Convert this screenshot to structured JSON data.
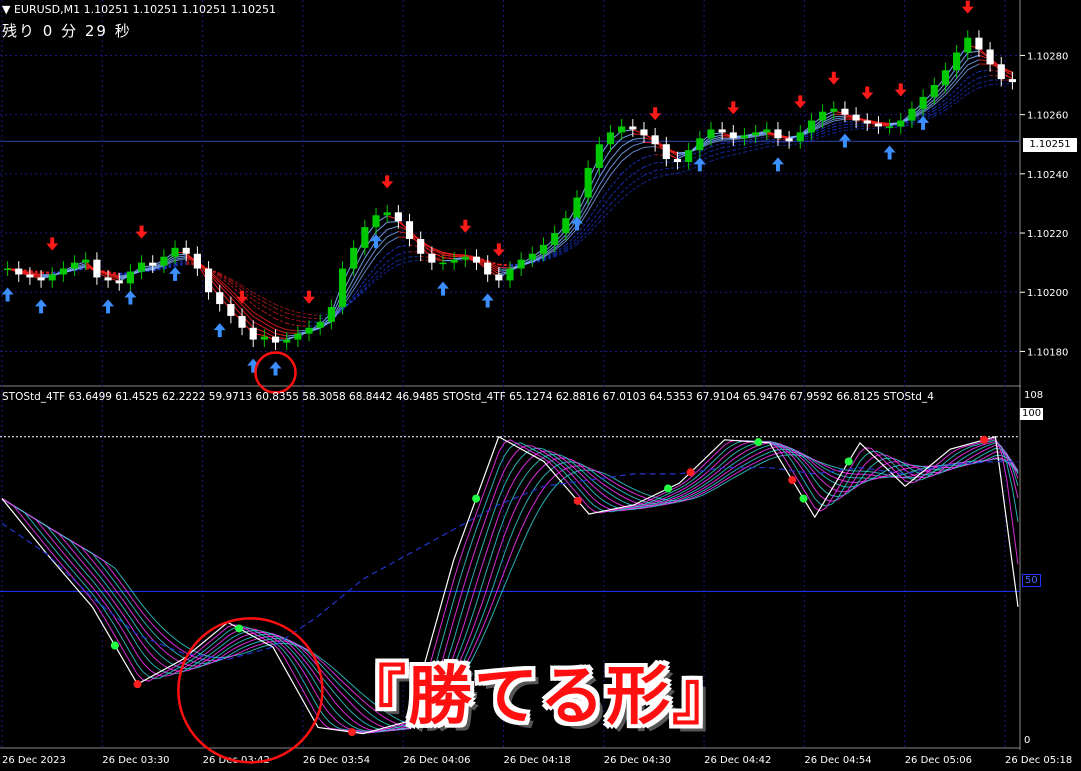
{
  "header": {
    "symbol_line": "▼ EURUSD,M1  1.10251  1.10251  1.10251  1.10251",
    "countdown": "残り 0 分 29 秒",
    "current_price": "1.10251"
  },
  "indicator": {
    "header": "STOStd_4TF 63.6499 61.4525 62.2222 59.9713 60.8355 58.3058 68.8442 46.9485  STOStd_4TF 65.1274 62.8816 67.0103 64.5353 67.9104 65.9476 67.9592 66.8125  STOStd_4",
    "level_top": "100",
    "level_mid": "50",
    "scale_top": "108",
    "scale_bottom": "0"
  },
  "caption": "『勝てる形』",
  "colors": {
    "bull_candle": "#00c800",
    "bear_candle": "#ffffff",
    "down_arrow": "#ff1a1a",
    "up_arrow": "#3b8fff",
    "ribbon_red": "#ff2020",
    "ribbon_blue": "#2244ff",
    "stoch_magenta": "#ff33ff",
    "stoch_teal": "#33cccc",
    "grid": "#1a1a80",
    "highlight_circle": "#ff1010"
  },
  "chart_data": [
    {
      "type": "candlestick",
      "symbol": "EURUSD",
      "timeframe": "M1",
      "y_ticks": [
        "1.10280",
        "1.10260",
        "1.10240",
        "1.10220",
        "1.10200",
        "1.10180"
      ],
      "ylim": [
        1.10169,
        1.10294
      ],
      "x_ticks": [
        "26 Dec 2023",
        "26 Dec 03:30",
        "26 Dec 03:42",
        "26 Dec 03:54",
        "26 Dec 04:06",
        "26 Dec 04:18",
        "26 Dec 04:30",
        "26 Dec 04:42",
        "26 Dec 04:54",
        "26 Dec 05:06",
        "26 Dec 05:18"
      ],
      "close_path": [
        1.10208,
        1.10206,
        1.10205,
        1.10204,
        1.10206,
        1.10208,
        1.1021,
        1.10211,
        1.10205,
        1.10204,
        1.10203,
        1.10207,
        1.1021,
        1.10209,
        1.10212,
        1.10215,
        1.10213,
        1.10208,
        1.102,
        1.10196,
        1.10192,
        1.10188,
        1.10184,
        1.10185,
        1.10183,
        1.10184,
        1.10186,
        1.10188,
        1.1019,
        1.10195,
        1.10208,
        1.10215,
        1.10222,
        1.10226,
        1.10227,
        1.10224,
        1.10218,
        1.10213,
        1.1021,
        1.1021,
        1.10211,
        1.10212,
        1.1021,
        1.10206,
        1.10204,
        1.10208,
        1.10211,
        1.10213,
        1.10216,
        1.1022,
        1.10225,
        1.10232,
        1.10242,
        1.1025,
        1.10254,
        1.10256,
        1.10255,
        1.10253,
        1.1025,
        1.10245,
        1.10244,
        1.10248,
        1.10252,
        1.10255,
        1.10254,
        1.10252,
        1.10253,
        1.10254,
        1.10255,
        1.10252,
        1.10251,
        1.10254,
        1.10258,
        1.10261,
        1.10262,
        1.1026,
        1.10258,
        1.10257,
        1.10256,
        1.10256,
        1.10258,
        1.10262,
        1.10266,
        1.1027,
        1.10275,
        1.10281,
        1.10286,
        1.10282,
        1.10277,
        1.10272,
        1.10271
      ],
      "down_arrows_at_bar": [
        4,
        12,
        21,
        27,
        34,
        41,
        44,
        58,
        65,
        71,
        74,
        77,
        80,
        86
      ],
      "up_arrows_at_bar": [
        0,
        3,
        9,
        11,
        15,
        19,
        22,
        24,
        33,
        39,
        43,
        51,
        62,
        69,
        75,
        79,
        82
      ]
    },
    {
      "type": "line",
      "name": "STOStd_4TF",
      "ylim": [
        0,
        108
      ],
      "levels": [
        100,
        50
      ],
      "x": [
        0,
        4,
        8,
        12,
        16,
        20,
        24,
        28,
        32,
        36,
        40,
        44,
        48,
        52,
        56,
        60,
        64,
        68,
        72,
        76,
        80,
        84,
        88,
        90
      ],
      "main_line": [
        80,
        62,
        45,
        20,
        28,
        40,
        32,
        6,
        4,
        8,
        60,
        100,
        92,
        75,
        78,
        85,
        99,
        98,
        74,
        98,
        84,
        96,
        100,
        45
      ],
      "slow_dashed": [
        72,
        62,
        48,
        36,
        30,
        28,
        32,
        42,
        54,
        62,
        70,
        78,
        84,
        86,
        88,
        88,
        90,
        90,
        88,
        90,
        88,
        91,
        92,
        92
      ],
      "red_dots_x": [
        12,
        31,
        51,
        61,
        70,
        87
      ],
      "green_dots_x": [
        10,
        21,
        42,
        59,
        67,
        71,
        75
      ]
    }
  ]
}
